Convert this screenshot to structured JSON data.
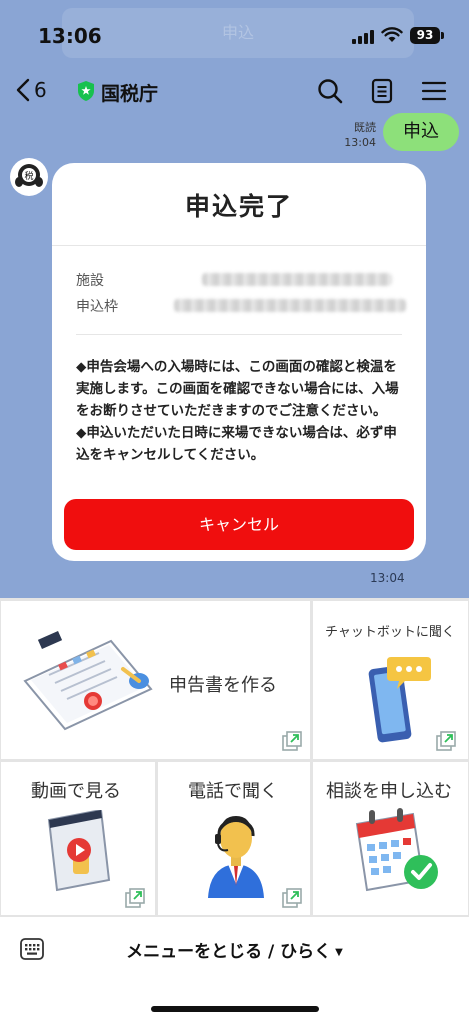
{
  "status_bar": {
    "time": "13:06",
    "battery": "93",
    "ghost_notification": "申込"
  },
  "header": {
    "back_count": "6",
    "title": "国税庁"
  },
  "messages": {
    "read_label": "既読",
    "user_time": "13:04",
    "user_text": "申込",
    "bot_time": "13:04"
  },
  "card": {
    "title": "申込完了",
    "fields": [
      {
        "label": "施設",
        "value_blurred": true
      },
      {
        "label": "申込枠",
        "value_blurred": true
      }
    ],
    "notice": [
      "◆申告会場への入場時には、この画面の確認と検温を実施します。この画面を確認できない場合には、入場をお断りさせていただきますのでご注意ください。",
      "◆申込いただいた日時に来場できない場合は、必ず申込をキャンセルしてください。"
    ],
    "cancel_label": "キャンセル"
  },
  "rich_menu": {
    "create_return": "申告書を作る",
    "chatbot": "チャットボットに聞く",
    "watch_video": "動画で見る",
    "phone": "電話で聞く",
    "consult": "相談を申し込む"
  },
  "menu_bar": {
    "toggle_label": "メニューをとじる / ひらく"
  },
  "colors": {
    "chat_bg": "#8aa5d4",
    "cancel_red": "#f00e0e",
    "user_bubble": "#8de07a",
    "verified_green": "#17c14e"
  }
}
